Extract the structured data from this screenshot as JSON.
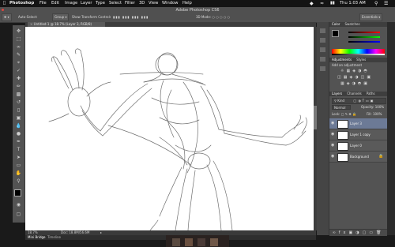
{
  "menubar": {
    "apple_icon": "apple-icon",
    "items": [
      "Photoshop",
      "File",
      "Edit",
      "Image",
      "Layer",
      "Type",
      "Select",
      "Filter",
      "3D",
      "View",
      "Window",
      "Help"
    ],
    "status_icons": [
      "dropbox-icon",
      "wifi-icon",
      "battery-icon"
    ],
    "time": "Thu 1:03 AM"
  },
  "window": {
    "title": "Adobe Photoshop CS6"
  },
  "options": {
    "auto_select": "Auto-Select:",
    "target": "Group",
    "show_transform": "Show Transform Controls",
    "mode_3d": "3D Mode:",
    "workspace": "Essentials"
  },
  "document": {
    "tab": "Untitled-1 @ 18.7% (Layer 3, RGB/8)",
    "zoom": "18.7%",
    "doc_size": "Doc: 18.8M/56.6M",
    "bottom_tabs": [
      "Mini Bridge",
      "Timeline"
    ]
  },
  "panels": {
    "color_tabs": [
      "Color",
      "Swatches"
    ],
    "adjustments_tabs": [
      "Adjustments",
      "Styles"
    ],
    "add_adjustment": "Add an adjustment",
    "layers_tabs": [
      "Layers",
      "Channels",
      "Paths"
    ],
    "kind": "Kind",
    "blend_mode": "Normal",
    "opacity_label": "Opacity:",
    "opacity_value": "100%",
    "lock_label": "Lock:",
    "fill_label": "Fill:",
    "fill_value": "100%",
    "layers": [
      {
        "name": "Layer 3"
      },
      {
        "name": "Layer 1 copy"
      },
      {
        "name": "Layer 0"
      },
      {
        "name": "Background"
      }
    ]
  }
}
